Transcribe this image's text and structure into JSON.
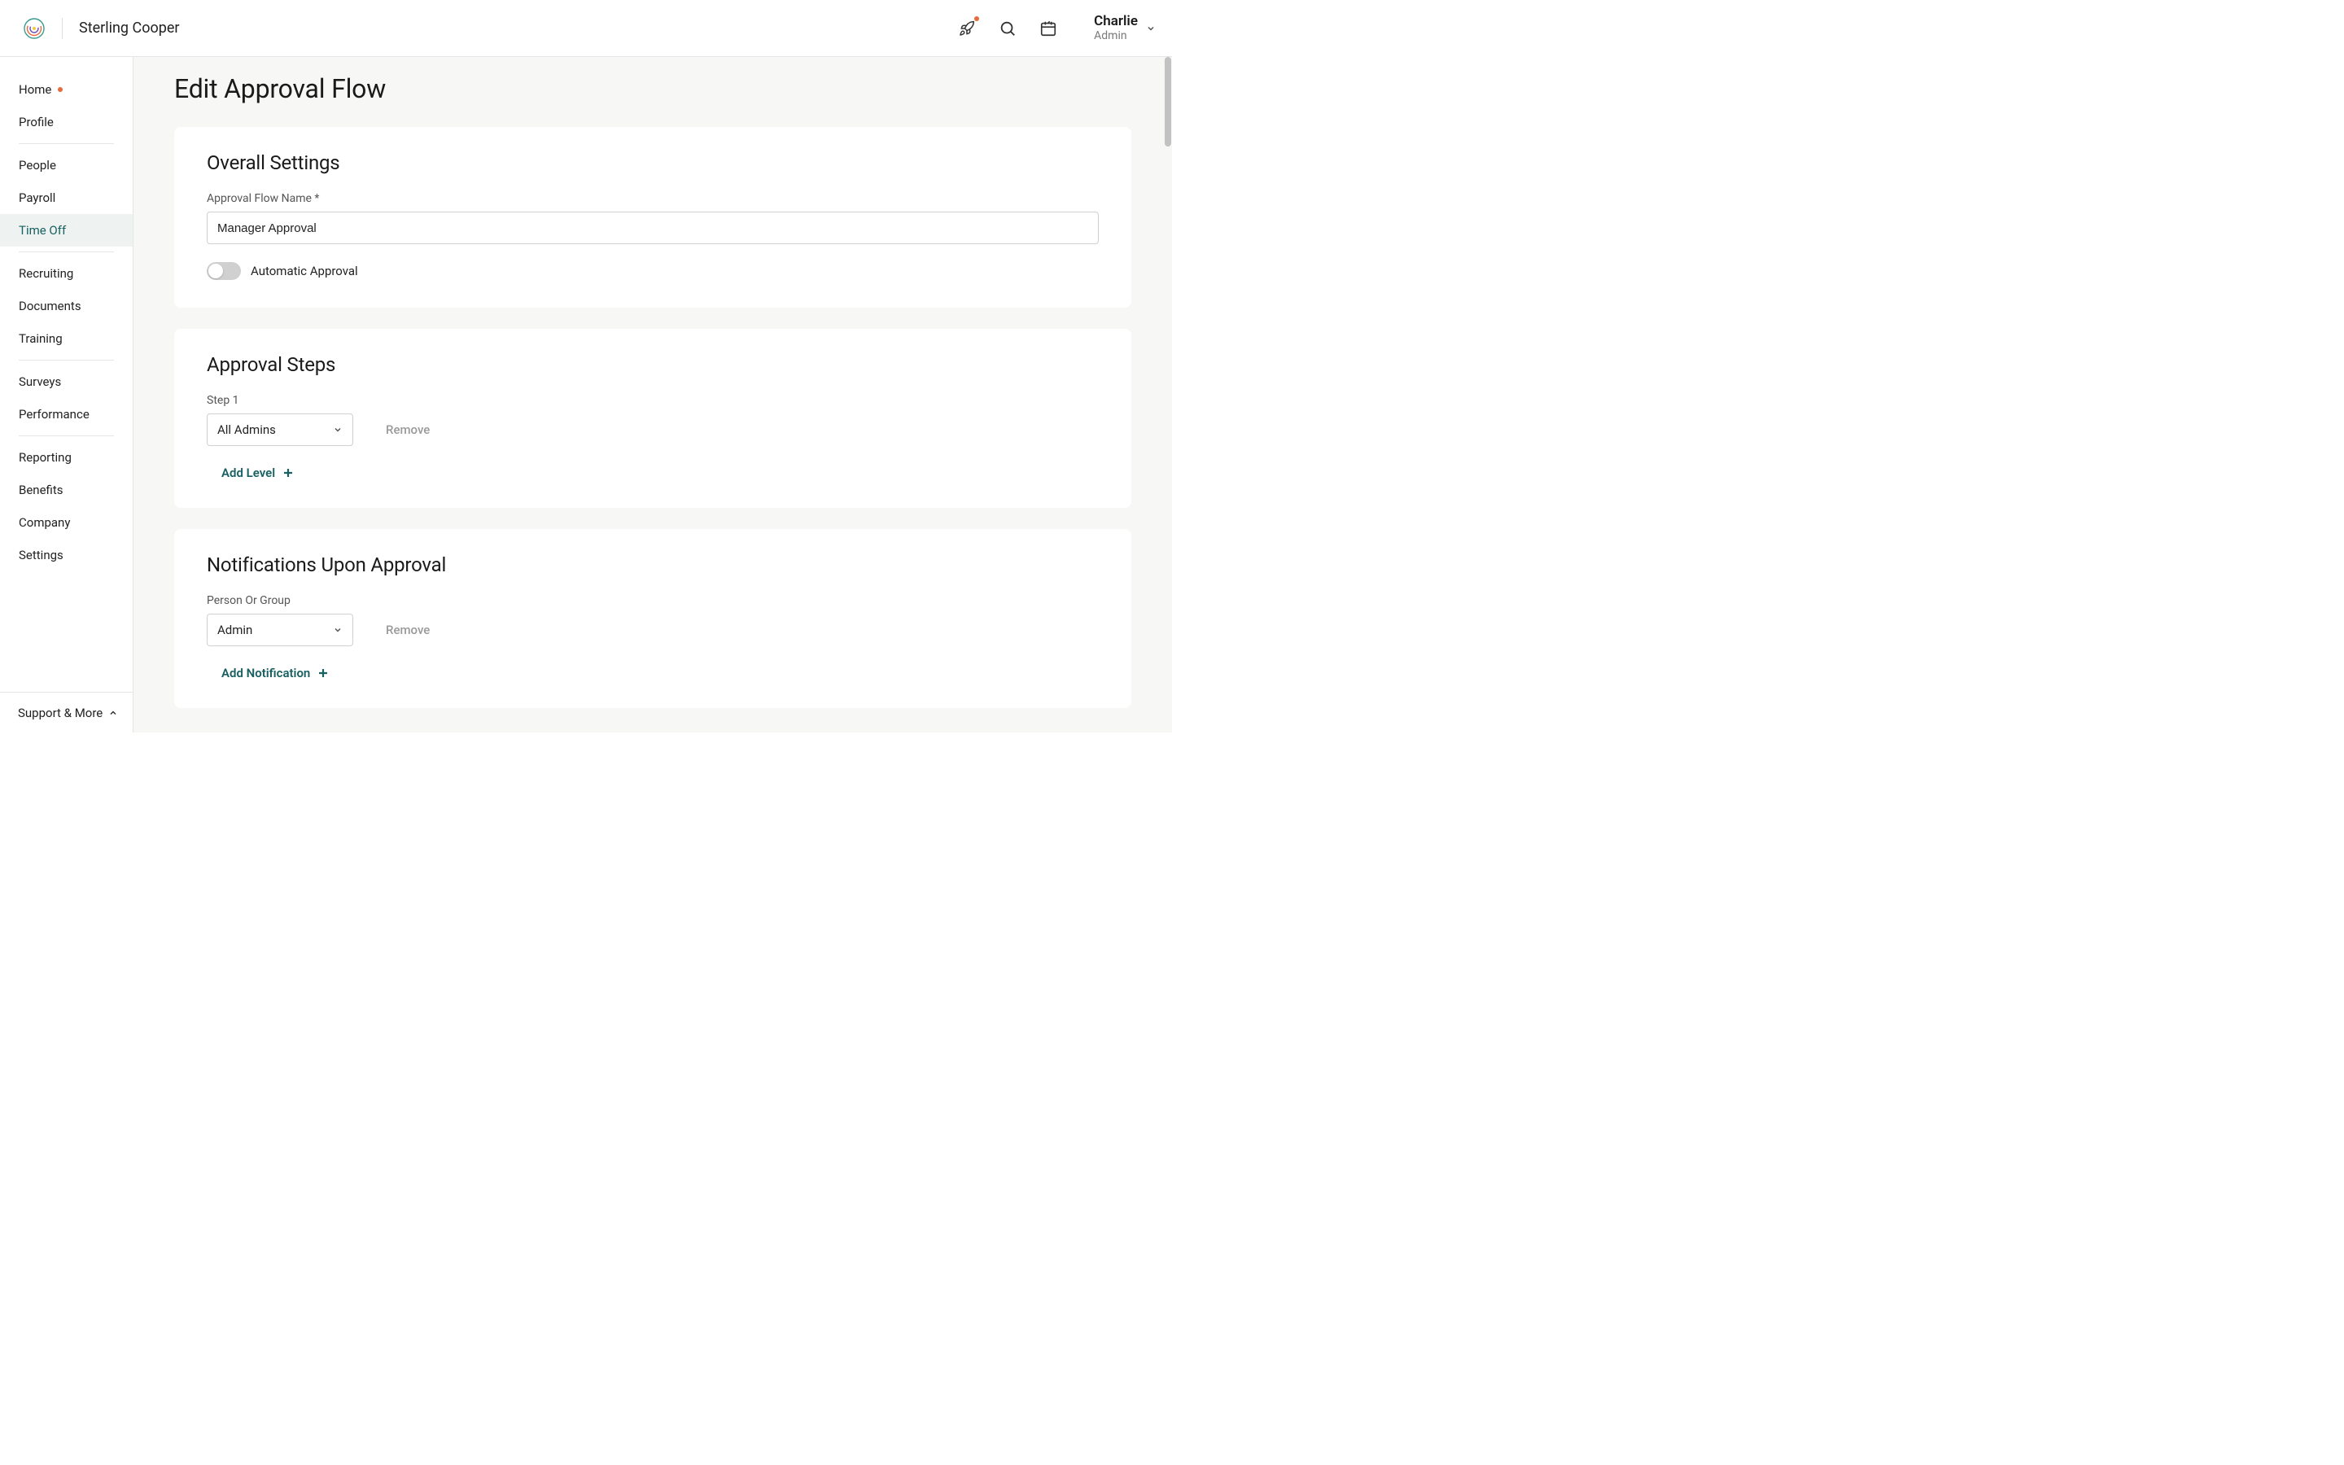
{
  "header": {
    "company_name": "Sterling Cooper",
    "user_name": "Charlie",
    "user_role": "Admin"
  },
  "sidebar": {
    "items": [
      {
        "label": "Home",
        "has_dot": true,
        "active": false
      },
      {
        "label": "Profile",
        "has_dot": false,
        "active": false
      }
    ],
    "items_group2": [
      {
        "label": "People",
        "active": false
      },
      {
        "label": "Payroll",
        "active": false
      },
      {
        "label": "Time Off",
        "active": true
      }
    ],
    "items_group3": [
      {
        "label": "Recruiting",
        "active": false
      },
      {
        "label": "Documents",
        "active": false
      },
      {
        "label": "Training",
        "active": false
      }
    ],
    "items_group4": [
      {
        "label": "Surveys",
        "active": false
      },
      {
        "label": "Performance",
        "active": false
      }
    ],
    "items_group5": [
      {
        "label": "Reporting",
        "active": false
      },
      {
        "label": "Benefits",
        "active": false
      },
      {
        "label": "Company",
        "active": false
      },
      {
        "label": "Settings",
        "active": false
      }
    ],
    "support_label": "Support & More"
  },
  "page": {
    "title": "Edit Approval Flow"
  },
  "overall_settings": {
    "title": "Overall Settings",
    "name_label": "Approval Flow Name *",
    "name_value": "Manager Approval",
    "auto_approval_label": "Automatic Approval",
    "auto_approval_on": false
  },
  "approval_steps": {
    "title": "Approval Steps",
    "step1_label": "Step 1",
    "step1_value": "All Admins",
    "remove_label": "Remove",
    "add_level_label": "Add Level"
  },
  "notifications": {
    "title": "Notifications Upon Approval",
    "field_label": "Person Or Group",
    "field_value": "Admin",
    "remove_label": "Remove",
    "add_notification_label": "Add Notification"
  }
}
